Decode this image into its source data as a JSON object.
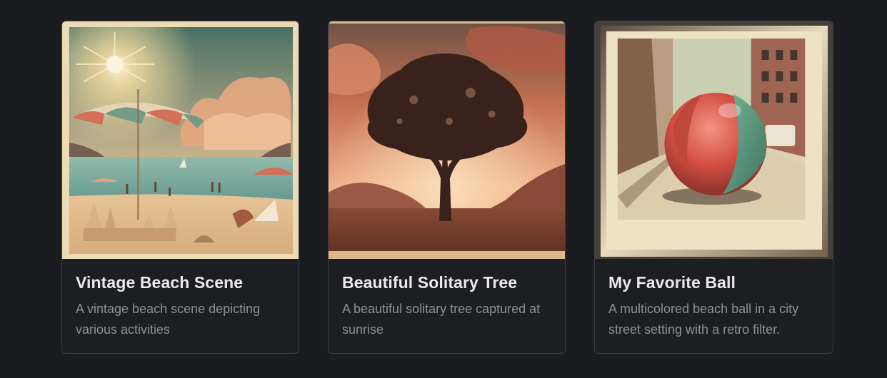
{
  "gallery": {
    "cards": [
      {
        "title": "Vintage Beach Scene",
        "description": "A vintage beach scene depicting various activities",
        "image_subject": "beach-photo"
      },
      {
        "title": "Beautiful Solitary Tree",
        "description": "A beautiful solitary tree captured at sunrise",
        "image_subject": "tree-photo"
      },
      {
        "title": "My Favorite Ball",
        "description": "A multicolored beach ball in a city street setting with a retro filter.",
        "image_subject": "ball-photo"
      }
    ]
  },
  "colors": {
    "page_background": "#1b1c1f",
    "card_background": "#1d1e22",
    "card_border": "#3b3d42",
    "title_text": "#eaeaea",
    "description_text": "#8e9096"
  }
}
